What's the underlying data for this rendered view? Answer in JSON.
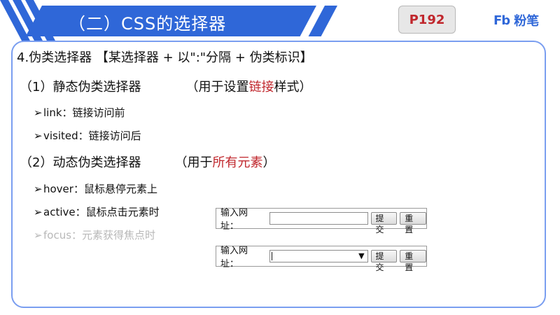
{
  "header": {
    "title": "（二）CSS的选择器",
    "page": "P192",
    "brand_logo": "Fb",
    "brand_text": "粉笔"
  },
  "content": {
    "heading": "4.伪类选择器 【某选择器 + 以\":\"分隔 + 伪类标识】",
    "static": {
      "num": "（1）",
      "title": "静态伪类选择器",
      "note_prefix": "（用于设置",
      "note_highlight": "链接",
      "note_suffix": "样式）",
      "items": [
        "link：链接访问前",
        "visited：链接访问后"
      ]
    },
    "dynamic": {
      "num": "（2）",
      "title": "动态伪类选择器",
      "note_prefix": "（用于",
      "note_highlight": "所有元素",
      "note_suffix": "）",
      "items": [
        "hover：鼠标悬停元素上",
        "active：鼠标点击元素时",
        "focus：元素获得焦点时"
      ]
    }
  },
  "form1": {
    "label": "输入网址：",
    "submit": "提交",
    "reset": "重置"
  },
  "form2": {
    "label": "输入网址：",
    "submit": "提交",
    "reset": "重置",
    "caret": "▼"
  },
  "colors": {
    "accent": "#2f67d8",
    "highlight": "#c0272d",
    "panel_border": "#7a9ef0"
  },
  "icons": {
    "bullet": "➢"
  }
}
